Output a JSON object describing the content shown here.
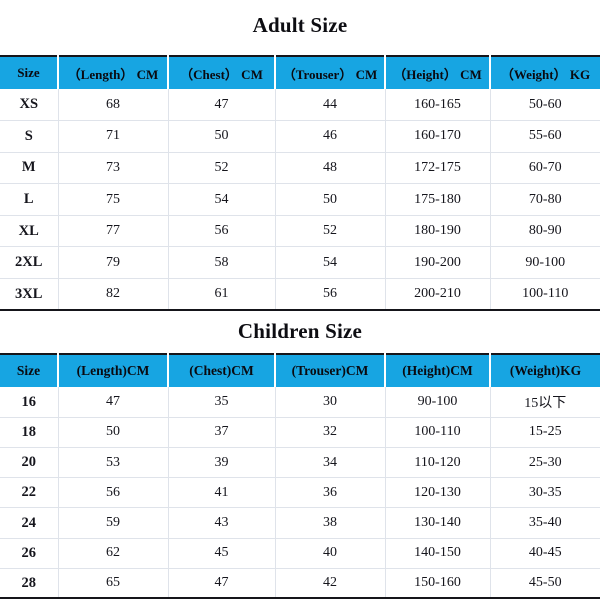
{
  "adult": {
    "title": "Adult Size",
    "headers": [
      "Size",
      "（Length） CM",
      "（Chest） CM",
      "（Trouser） CM",
      "（Height） CM",
      "（Weight） KG"
    ],
    "rows": [
      {
        "size": "XS",
        "length": "68",
        "chest": "47",
        "trouser": "44",
        "height": "160-165",
        "weight": "50-60"
      },
      {
        "size": "S",
        "length": "71",
        "chest": "50",
        "trouser": "46",
        "height": "160-170",
        "weight": "55-60"
      },
      {
        "size": "M",
        "length": "73",
        "chest": "52",
        "trouser": "48",
        "height": "172-175",
        "weight": "60-70"
      },
      {
        "size": "L",
        "length": "75",
        "chest": "54",
        "trouser": "50",
        "height": "175-180",
        "weight": "70-80"
      },
      {
        "size": "XL",
        "length": "77",
        "chest": "56",
        "trouser": "52",
        "height": "180-190",
        "weight": "80-90"
      },
      {
        "size": "2XL",
        "length": "79",
        "chest": "58",
        "trouser": "54",
        "height": "190-200",
        "weight": "90-100"
      },
      {
        "size": "3XL",
        "length": "82",
        "chest": "61",
        "trouser": "56",
        "height": "200-210",
        "weight": "100-110"
      }
    ]
  },
  "children": {
    "title": "Children Size",
    "headers": [
      "Size",
      "(Length)CM",
      "(Chest)CM",
      "(Trouser)CM",
      "(Height)CM",
      "(Weight)KG"
    ],
    "rows": [
      {
        "size": "16",
        "length": "47",
        "chest": "35",
        "trouser": "30",
        "height": "90-100",
        "weight": "15以下"
      },
      {
        "size": "18",
        "length": "50",
        "chest": "37",
        "trouser": "32",
        "height": "100-110",
        "weight": "15-25"
      },
      {
        "size": "20",
        "length": "53",
        "chest": "39",
        "trouser": "34",
        "height": "110-120",
        "weight": "25-30"
      },
      {
        "size": "22",
        "length": "56",
        "chest": "41",
        "trouser": "36",
        "height": "120-130",
        "weight": "30-35"
      },
      {
        "size": "24",
        "length": "59",
        "chest": "43",
        "trouser": "38",
        "height": "130-140",
        "weight": "35-40"
      },
      {
        "size": "26",
        "length": "62",
        "chest": "45",
        "trouser": "40",
        "height": "140-150",
        "weight": "40-45"
      },
      {
        "size": "28",
        "length": "65",
        "chest": "47",
        "trouser": "42",
        "height": "150-160",
        "weight": "45-50"
      }
    ]
  },
  "colors": {
    "header_background": "#17a5e2",
    "header_text": "#0a0a10",
    "body_text": "#15151c",
    "grid_line": "#dfe3ea",
    "outer_border": "#15151a",
    "page_background": "#ffffff"
  }
}
